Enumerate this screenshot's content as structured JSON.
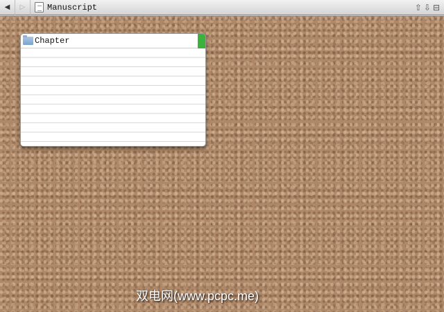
{
  "header": {
    "back_icon": "◀",
    "forward_icon": "▷",
    "title": "Manuscript",
    "up_icon": "⇧",
    "down_icon": "⇩",
    "split_icon": "⊟"
  },
  "card": {
    "title": "Chapter",
    "label_color": "#3bb33b"
  },
  "watermark": "双电网(www.pcpc.me)"
}
